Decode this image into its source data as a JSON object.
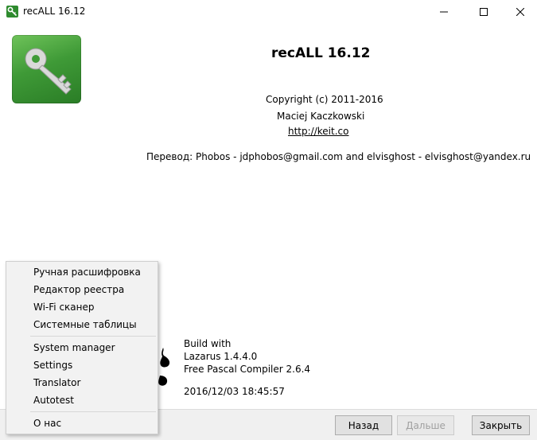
{
  "window": {
    "title": "recALL 16.12"
  },
  "about": {
    "app_name": "recALL 16.12",
    "copyright": "Copyright (c) 2011-2016",
    "author": "Maciej Kaczkowski",
    "website": "http://keit.co",
    "translation": "Перевод: Phobos - jdphobos@gmail.com and elvisghost - elvisghost@yandex.ru"
  },
  "build": {
    "line1": "Build with",
    "line2": "Lazarus 1.4.4.0",
    "line3": "Free Pascal Compiler 2.6.4",
    "date": "2016/12/03 18:45:57"
  },
  "menu": {
    "items": [
      "Ручная расшифровка",
      "Редактор реестра",
      "Wi-Fi сканер",
      "Системные таблицы",
      "System manager",
      "Settings",
      "Translator",
      "Autotest",
      "О нас"
    ]
  },
  "buttons": {
    "back": "Назад",
    "next": "Дальше",
    "close": "Закрыть"
  },
  "colors": {
    "logo_green": "#3f9a37",
    "footer_bg": "#f0f0f0"
  }
}
